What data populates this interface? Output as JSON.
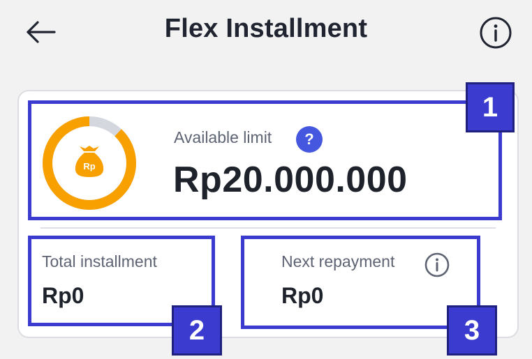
{
  "header": {
    "title": "Flex Installment"
  },
  "icons": {
    "back": "arrow-left-icon",
    "info": "info-circle-icon",
    "money_bag": "money-bag-icon",
    "help": "question-icon"
  },
  "colors": {
    "accent": "#4457de",
    "ring_orange": "#f7a000",
    "ring_track": "#d4d8de",
    "highlight": "#3b3ccf"
  },
  "limit": {
    "label": "Available limit",
    "help_glyph": "?",
    "value": "Rp20.000.000",
    "ring_fraction": 0.88,
    "currency_badge": "Rp"
  },
  "total_installment": {
    "label": "Total installment",
    "value": "Rp0"
  },
  "next_repayment": {
    "label": "Next repayment",
    "value": "Rp0"
  },
  "annotations": [
    "1",
    "2",
    "3"
  ]
}
